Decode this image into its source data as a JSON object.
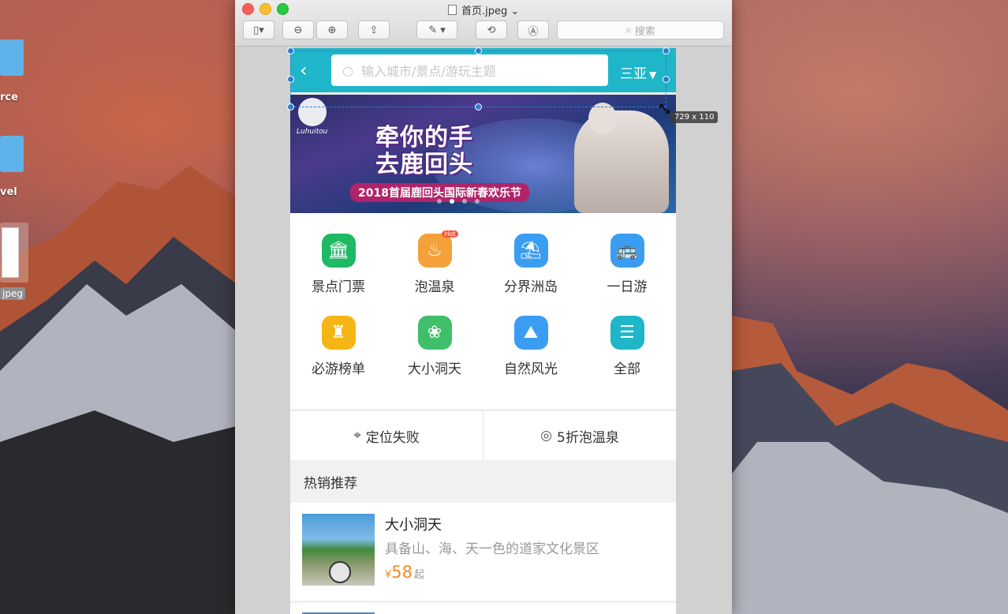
{
  "desktop": {
    "label_1": "rce",
    "label_2": "vel",
    "thumb_label": "jpeg"
  },
  "window": {
    "title": "首页.jpeg",
    "search_placeholder": "搜索"
  },
  "app": {
    "search_placeholder": "输入城市/景点/游玩主题",
    "city": "三亚",
    "banner": {
      "logo_text": "Luhuitou",
      "title_line1": "牵你的手",
      "title_line2": "去鹿回头",
      "subtitle": "2018首届鹿回头国际新春欢乐节"
    },
    "categories": [
      {
        "label": "景点门票",
        "icon": "museum-icon",
        "color": "#1fb865"
      },
      {
        "label": "泡温泉",
        "icon": "hot-spring-icon",
        "color": "#f5a13a",
        "badge": "Hot"
      },
      {
        "label": "分界洲岛",
        "icon": "island-icon",
        "color": "#3a9df2"
      },
      {
        "label": "一日游",
        "icon": "bus-icon",
        "color": "#3a9df2"
      },
      {
        "label": "必游榜单",
        "icon": "castle-icon",
        "color": "#f5b514"
      },
      {
        "label": "大小洞天",
        "icon": "tree-icon",
        "color": "#3fbf6a"
      },
      {
        "label": "自然风光",
        "icon": "mountain-icon",
        "color": "#3a9df2"
      },
      {
        "label": "全部",
        "icon": "menu-icon",
        "color": "#1eb6c8"
      }
    ],
    "location_failed": "定位失败",
    "promo": "5折泡温泉",
    "section_title": "热销推荐",
    "items": [
      {
        "name": "大小洞天",
        "desc": "具备山、海、天一色的道家文化景区",
        "currency": "¥",
        "price": "58",
        "suffix": "起"
      }
    ]
  },
  "selection_size": "729 x 110"
}
